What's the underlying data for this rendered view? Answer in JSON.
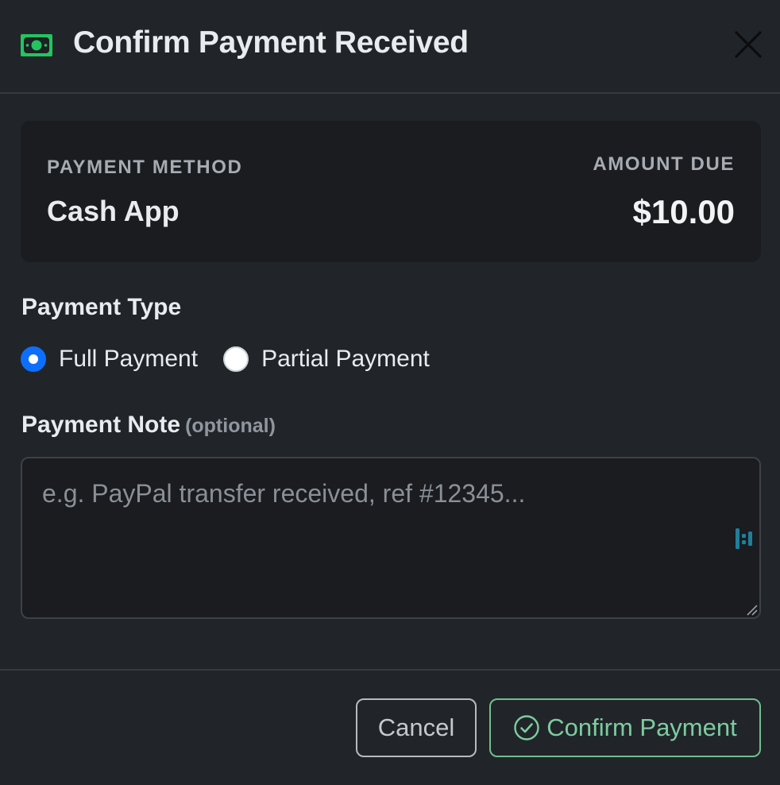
{
  "dialog": {
    "title": "Confirm Payment Received",
    "header_icon": "cash-icon",
    "close_icon": "close-icon"
  },
  "summary": {
    "method_label": "PAYMENT METHOD",
    "method_value": "Cash App",
    "amount_label": "AMOUNT DUE",
    "amount_value": "$10.00"
  },
  "payment_type": {
    "label": "Payment Type",
    "options": [
      {
        "label": "Full Payment",
        "checked": true
      },
      {
        "label": "Partial Payment",
        "checked": false
      }
    ]
  },
  "payment_note": {
    "label": "Payment Note",
    "optional_hint": "(optional)",
    "value": "",
    "placeholder": "e.g. PayPal transfer received, ref #12345..."
  },
  "footer": {
    "cancel_label": "Cancel",
    "confirm_label": "Confirm Payment",
    "confirm_icon": "check-circle-icon"
  },
  "colors": {
    "background": "#212529",
    "card": "#1a1c1f",
    "accent_blue": "#0d6efd",
    "success_green": "#22c55e",
    "confirm_outline": "#6fbf8f"
  }
}
